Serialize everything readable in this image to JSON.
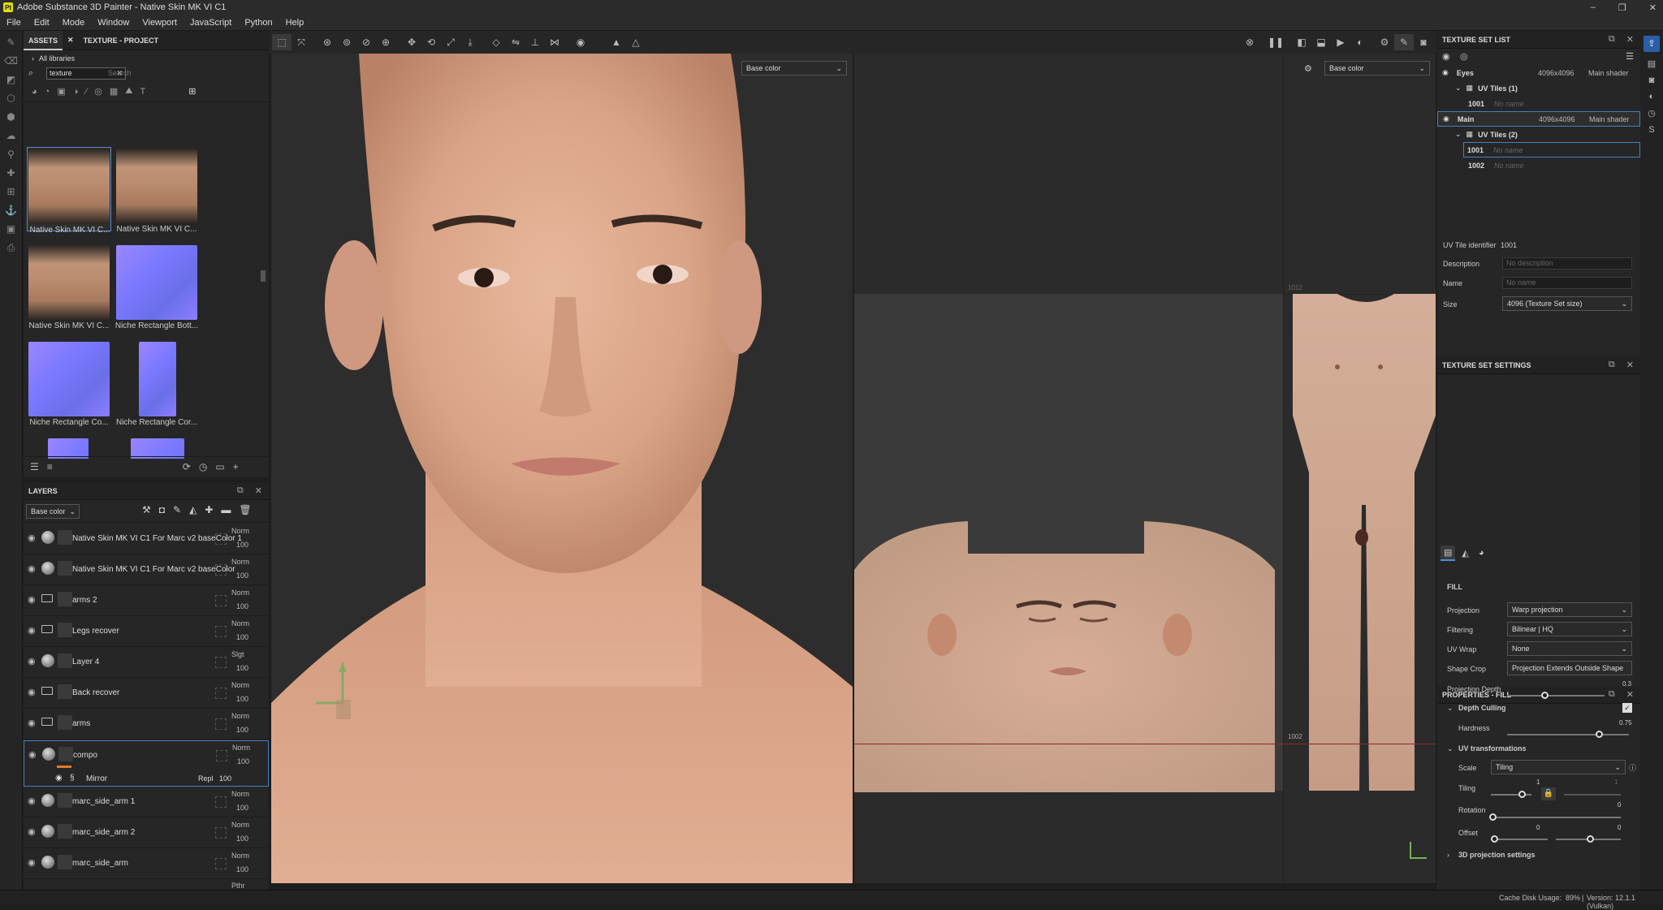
{
  "app": {
    "title": "Adobe Substance 3D Painter - Native Skin MK VI C1",
    "icon_text": "Pt"
  },
  "window_controls": [
    "–",
    "❐",
    "✕"
  ],
  "menu": [
    "File",
    "Edit",
    "Mode",
    "Window",
    "Viewport",
    "JavaScript",
    "Python",
    "Help"
  ],
  "assets_panel": {
    "tabs": [
      "ASSETS",
      "TEXTURE - PROJECT"
    ],
    "library": "All libraries",
    "search_value": "texture",
    "search_placeholder": "Search",
    "items": [
      {
        "label": "Native Skin MK VI C...",
        "kind": "skin"
      },
      {
        "label": "Native Skin MK VI C...",
        "kind": "skin"
      },
      {
        "label": "Native Skin MK VI C...",
        "kind": "skin"
      },
      {
        "label": "Niche Rectangle Bott...",
        "kind": "normal"
      },
      {
        "label": "Niche Rectangle Co...",
        "kind": "normal"
      },
      {
        "label": "Niche Rectangle Cor...",
        "kind": "normal"
      },
      {
        "label": "",
        "kind": "normal"
      },
      {
        "label": "",
        "kind": "normal"
      }
    ]
  },
  "layers_panel": {
    "title": "LAYERS",
    "channel": "Base color",
    "rows": [
      {
        "name": "Native Skin MK VI C1 For Marc v2 baseColor 1",
        "blend": "Norm",
        "opacity": "100",
        "icon": "sphere"
      },
      {
        "name": "Native Skin MK VI C1 For Marc v2 baseColor",
        "blend": "Norm",
        "opacity": "100",
        "icon": "sphere"
      },
      {
        "name": "arms 2",
        "blend": "Norm",
        "opacity": "100",
        "icon": "folder"
      },
      {
        "name": "Legs recover",
        "blend": "Norm",
        "opacity": "100",
        "icon": "folder"
      },
      {
        "name": "Layer 4",
        "blend": "Slgt",
        "opacity": "100",
        "icon": "brush"
      },
      {
        "name": "Back recover",
        "blend": "Norm",
        "opacity": "100",
        "icon": "folder"
      },
      {
        "name": "arms",
        "blend": "Norm",
        "opacity": "100",
        "icon": "folder"
      },
      {
        "name": "compo",
        "blend": "Norm",
        "opacity": "100",
        "icon": "sphere"
      },
      {
        "name": "marc_side_arm 1",
        "blend": "Norm",
        "opacity": "100",
        "icon": "sphere"
      },
      {
        "name": "marc_side_arm 2",
        "blend": "Norm",
        "opacity": "100",
        "icon": "sphere"
      },
      {
        "name": "marc_side_arm",
        "blend": "Norm",
        "opacity": "100",
        "icon": "sphere"
      }
    ],
    "effect": {
      "name": "Mirror",
      "blend": "Repl",
      "opacity": "100"
    },
    "last_blend": "Pthr"
  },
  "viewport": {
    "channel_3d": "Base color",
    "channel_2d": "Base color",
    "tile_labels": [
      "1012",
      "1002"
    ]
  },
  "texture_set_list": {
    "title": "TEXTURE SET LIST",
    "sets": [
      {
        "name": "Eyes",
        "size": "4096x4096",
        "shader": "Main shader",
        "uv": "UV Tiles (1)",
        "tiles": [
          {
            "id": "1001",
            "name": "No name"
          }
        ]
      },
      {
        "name": "Main",
        "size": "4096x4096",
        "shader": "Main shader",
        "uv": "UV Tiles (2)",
        "tiles": [
          {
            "id": "1001",
            "name": "No name"
          },
          {
            "id": "1002",
            "name": "No name"
          }
        ]
      }
    ]
  },
  "texture_set_settings": {
    "title": "TEXTURE SET SETTINGS",
    "uv_tile_label": "UV Tile identifier",
    "uv_tile_value": "1001",
    "description_label": "Description",
    "description_placeholder": "No description",
    "name_label": "Name",
    "name_placeholder": "No name",
    "size_label": "Size",
    "size_value": "4096 (Texture Set size)"
  },
  "properties": {
    "title": "PROPERTIES - FILL",
    "section": "FILL",
    "projection_label": "Projection",
    "projection": "Warp projection",
    "filtering_label": "Filtering",
    "filtering": "Bilinear | HQ",
    "uvwrap_label": "UV Wrap",
    "uvwrap": "None",
    "shapecrop_label": "Shape Crop",
    "shapecrop": "Projection Extends Outside Shape",
    "projdepth_label": "Projection Depth",
    "projdepth": "0.3",
    "depthculling_label": "Depth Culling",
    "hardness_label": "Hardness",
    "hardness": "0.75",
    "uvtrans_label": "UV transformations",
    "scale_label": "Scale",
    "scale": "Tiling",
    "tiling_label": "Tiling",
    "tiling_a": "1",
    "tiling_b": "1",
    "rotation_label": "Rotation",
    "rotation": "0",
    "offset_label": "Offset",
    "offset_a": "0",
    "offset_b": "0",
    "proj3d_label": "3D projection settings"
  },
  "status": {
    "cache": "Cache Disk Usage:",
    "cache_value": "89%",
    "version": "Version: 12.1.1 (Vulkan)"
  }
}
